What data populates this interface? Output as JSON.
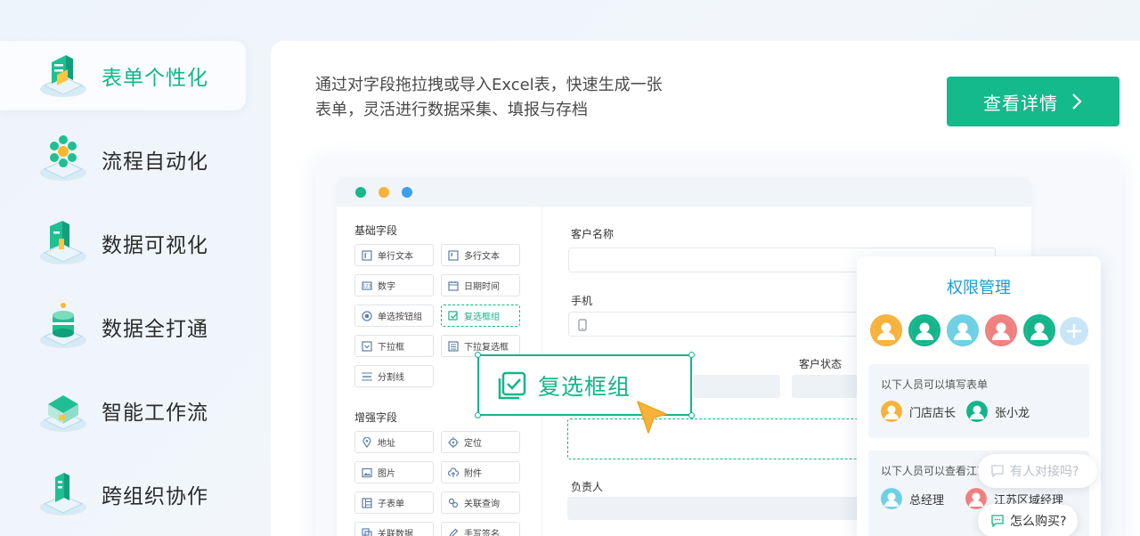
{
  "nav": {
    "items": [
      {
        "label": "表单个性化",
        "icon": "form-cube-icon",
        "active": true
      },
      {
        "label": "流程自动化",
        "icon": "process-cube-icon",
        "active": false
      },
      {
        "label": "数据可视化",
        "icon": "chart-cube-icon",
        "active": false
      },
      {
        "label": "数据全打通",
        "icon": "database-cube-icon",
        "active": false
      },
      {
        "label": "智能工作流",
        "icon": "workflow-cube-icon",
        "active": false
      },
      {
        "label": "跨组织协作",
        "icon": "collab-cube-icon",
        "active": false
      }
    ]
  },
  "main": {
    "description": "通过对字段拖拉拽或导入Excel表，快速生成一张表单，灵活进行数据采集、填报与存档",
    "detail_button": "查看详情"
  },
  "builder": {
    "basic_title": "基础字段",
    "basic_fields": [
      "单行文本",
      "多行文本",
      "数字",
      "日期时间",
      "单选按钮组",
      "复选框组",
      "下拉框",
      "下拉复选框",
      "分割线"
    ],
    "advanced_title": "增强字段",
    "advanced_fields": [
      "地址",
      "定位",
      "图片",
      "附件",
      "子表单",
      "关联查询",
      "关联数据",
      "手写签名"
    ],
    "form": {
      "customer_name": "客户名称",
      "phone": "手机",
      "customer_status": "客户状态",
      "owner": "负责人"
    },
    "dragging_label": "复选框组"
  },
  "permissions": {
    "title": "权限管理",
    "fill_title": "以下人员可以填写表单",
    "fill_people": [
      "门店店长",
      "张小龙"
    ],
    "view_title": "以下人员可以查看江苏",
    "view_people": [
      "总经理",
      "江苏区域经理"
    ]
  },
  "chat": {
    "contact": "有人对接吗?",
    "buy": "怎么购买?"
  },
  "colors": {
    "accent": "#13b58a",
    "blue": "#1a9bd7"
  }
}
